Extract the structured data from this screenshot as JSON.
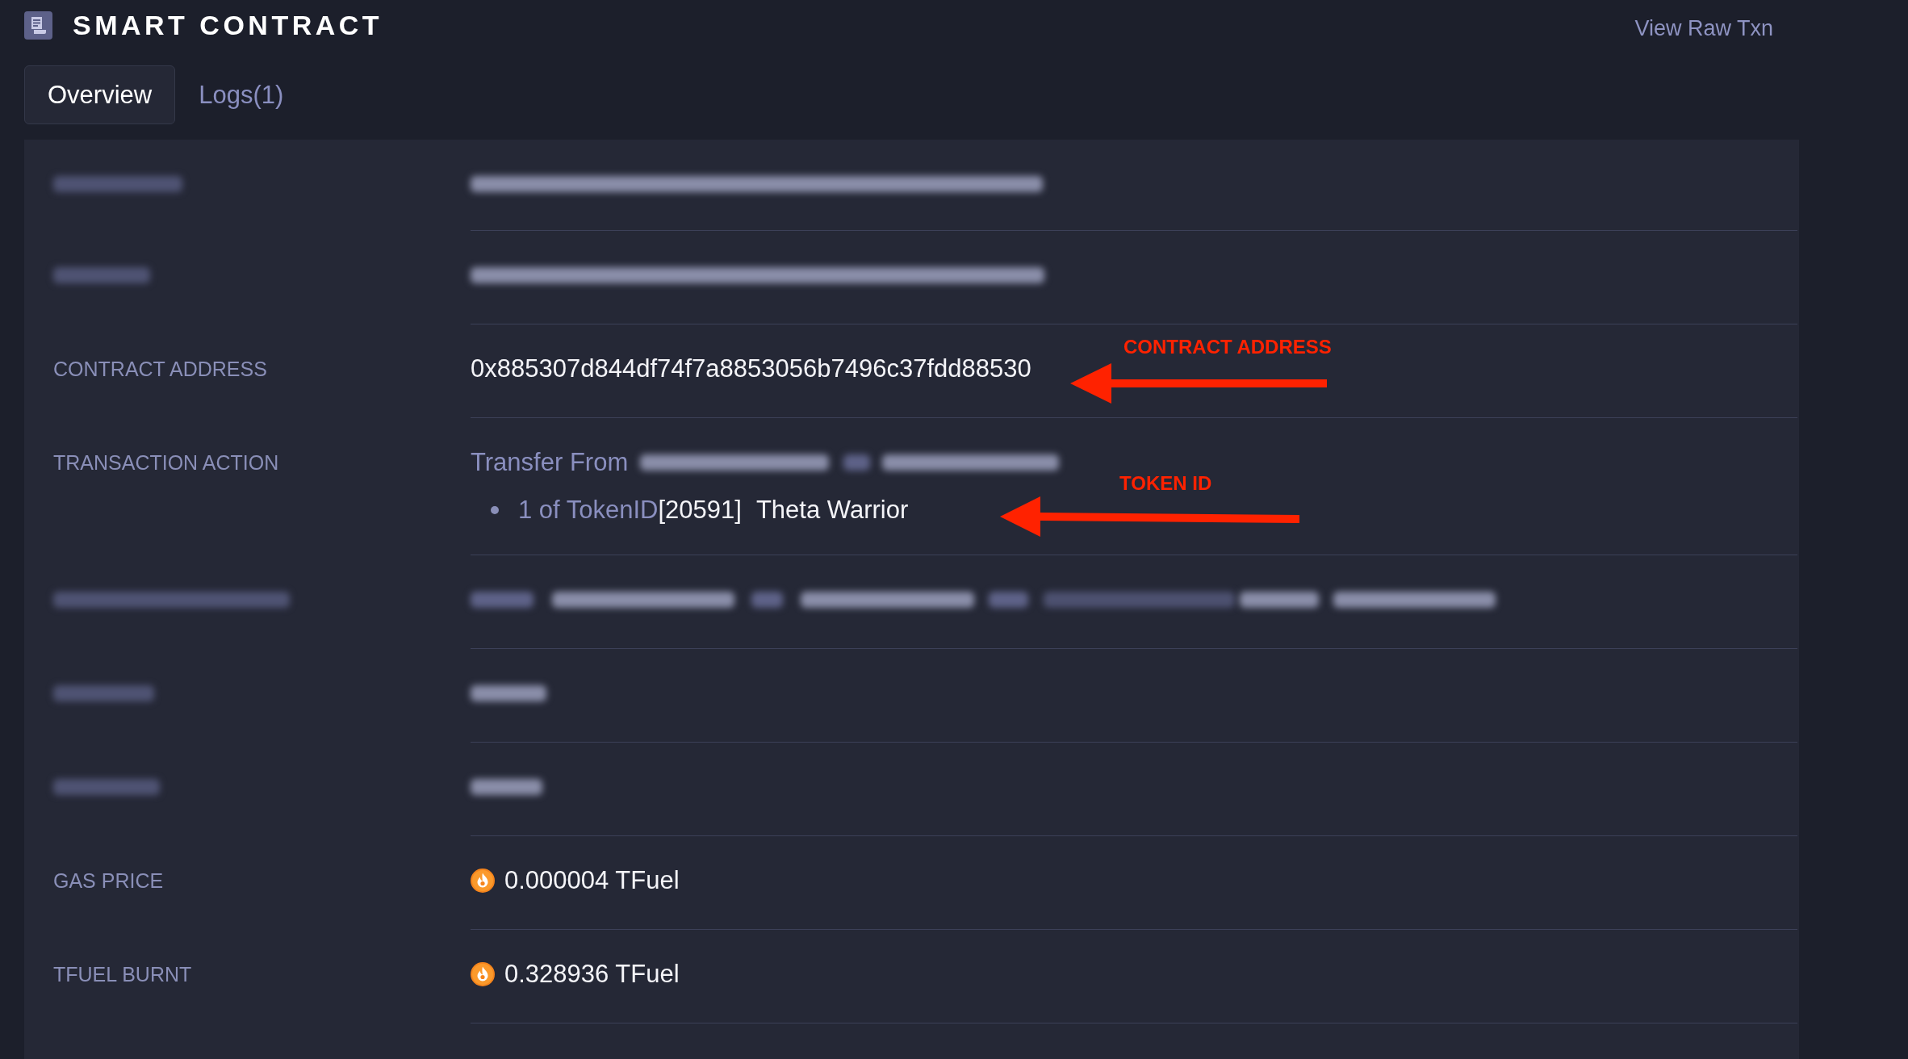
{
  "header": {
    "title": "SMART CONTRACT",
    "link": "View Raw Txn"
  },
  "tabs": [
    {
      "label": "Overview",
      "selected": true
    },
    {
      "label": "Logs(1)",
      "selected": false
    }
  ],
  "rows": [
    {
      "kind": "blurred"
    },
    {
      "kind": "blurred"
    },
    {
      "kind": "address",
      "label": "CONTRACT ADDRESS",
      "value": "0x885307d844df74f7a8853056b7496c37fdd88530",
      "annotation": "CONTRACT ADDRESS"
    },
    {
      "kind": "action",
      "label": "TRANSACTION ACTION",
      "prefix": "Transfer From",
      "token": {
        "quantity": "1 of TokenID",
        "id": "[20591]",
        "name": "Theta Warrior"
      },
      "annotation": "TOKEN ID"
    },
    {
      "kind": "blurred"
    },
    {
      "kind": "blurred"
    },
    {
      "kind": "blurred"
    },
    {
      "kind": "amount",
      "label": "GAS PRICE",
      "value": "0.000004 TFuel"
    },
    {
      "kind": "amount",
      "label": "TFUEL BURNT",
      "value": "0.328936 TFuel"
    }
  ]
}
